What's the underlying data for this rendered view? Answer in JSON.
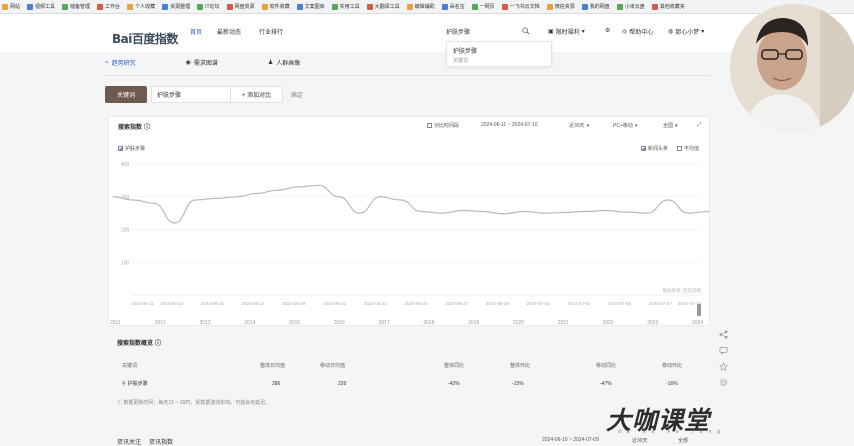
{
  "bookmarks": [
    "网站",
    "视频工具",
    "储备管理",
    "工作台",
    "个人收藏",
    "资源整理",
    "IT论坛",
    "网盘资源",
    "软件收藏",
    "文案图库",
    "实用工具",
    "大翻译工具",
    "编辑辅助",
    "朵名宝",
    "一网页",
    "一飞书云文档",
    "微信资源",
    "我的网盘",
    "小米云盘",
    "其他收藏夹"
  ],
  "logo": "Bai百度指数",
  "nav": [
    "首页",
    "最新动态",
    "行业排行"
  ],
  "search": {
    "value": "护肤步骤"
  },
  "top_right": {
    "limited": "限时福利",
    "help": "帮助中心",
    "user": "那心小梦"
  },
  "suggest": {
    "title": "护肤步骤",
    "sub": "关键词"
  },
  "subnav": [
    "趋势研究",
    "需求图谱",
    "人群画像"
  ],
  "keyword_bar": {
    "button": "关键词",
    "keyword": "护肤步骤",
    "add": "+ 添加对比",
    "confirm": "确定"
  },
  "chart_card": {
    "title": "搜索指数",
    "compare_label": "对比时间段",
    "date_range": "2024-06-11 ~ 2024-07-10",
    "period": "近30天",
    "device": "PC+移动",
    "region": "全国",
    "series_label": "护肤步骤",
    "legend_news": "新闻头条",
    "legend_avg": "平均值",
    "watermark_small": "数据来源: 百度指数"
  },
  "chart_data": {
    "type": "line",
    "x_tick_labels": [
      "2024-06-11",
      "2024-06-13",
      "2024-06-15",
      "2024-06-17",
      "2024-06-19",
      "2024-06-21",
      "2024-06-23",
      "2024-06-25",
      "2024-06-27",
      "2024-06-29",
      "2024-07-01",
      "2024-07-03",
      "2024-07-05",
      "2024-07-07",
      "2024-07-10"
    ],
    "y_tick_labels": [
      "400",
      "300",
      "200",
      "100"
    ],
    "ylim": [
      0,
      400
    ],
    "series": [
      {
        "name": "护肤步骤",
        "x": [
          "2024-06-11",
          "2024-06-12",
          "2024-06-13",
          "2024-06-14",
          "2024-06-15",
          "2024-06-16",
          "2024-06-17",
          "2024-06-18",
          "2024-06-19",
          "2024-06-20",
          "2024-06-21",
          "2024-06-22",
          "2024-06-23",
          "2024-06-24",
          "2024-06-25",
          "2024-06-26",
          "2024-06-27",
          "2024-06-28",
          "2024-06-29",
          "2024-06-30",
          "2024-07-01",
          "2024-07-02",
          "2024-07-03",
          "2024-07-04",
          "2024-07-05",
          "2024-07-06",
          "2024-07-07",
          "2024-07-08",
          "2024-07-09",
          "2024-07-10"
        ],
        "values": [
          300,
          290,
          280,
          220,
          290,
          295,
          300,
          310,
          320,
          330,
          335,
          300,
          250,
          300,
          290,
          255,
          250,
          258,
          255,
          248,
          255,
          250,
          252,
          255,
          258,
          253,
          250,
          290,
          250,
          255
        ]
      }
    ],
    "timeline_years": [
      "2011",
      "2012",
      "2013",
      "2014",
      "2015",
      "2016",
      "2017",
      "2018",
      "2019",
      "2020",
      "2021",
      "2022",
      "2023",
      "2024"
    ],
    "grid": true
  },
  "summary": {
    "title": "搜索指数概览",
    "headers": [
      "关键词",
      "整体日均值",
      "移动日均值",
      "整体同比",
      "整体环比",
      "移动同比",
      "移动环比"
    ],
    "row": [
      "护肤步骤",
      "286",
      "226",
      "-42%",
      "-15%",
      "-47%",
      "-16%"
    ],
    "note": "① 数据更新时间：每天12 ~ 16时，受数据波动影响，可能会有延迟。"
  },
  "bottom": {
    "title_a": "资讯关注",
    "title_b": "资讯指数",
    "date": "2024-06-10 ~ 2024-07-09",
    "period": "近30天",
    "all": "全部"
  },
  "watermark": {
    "main": "大咖课堂",
    "sub": "da ka ke tang"
  }
}
